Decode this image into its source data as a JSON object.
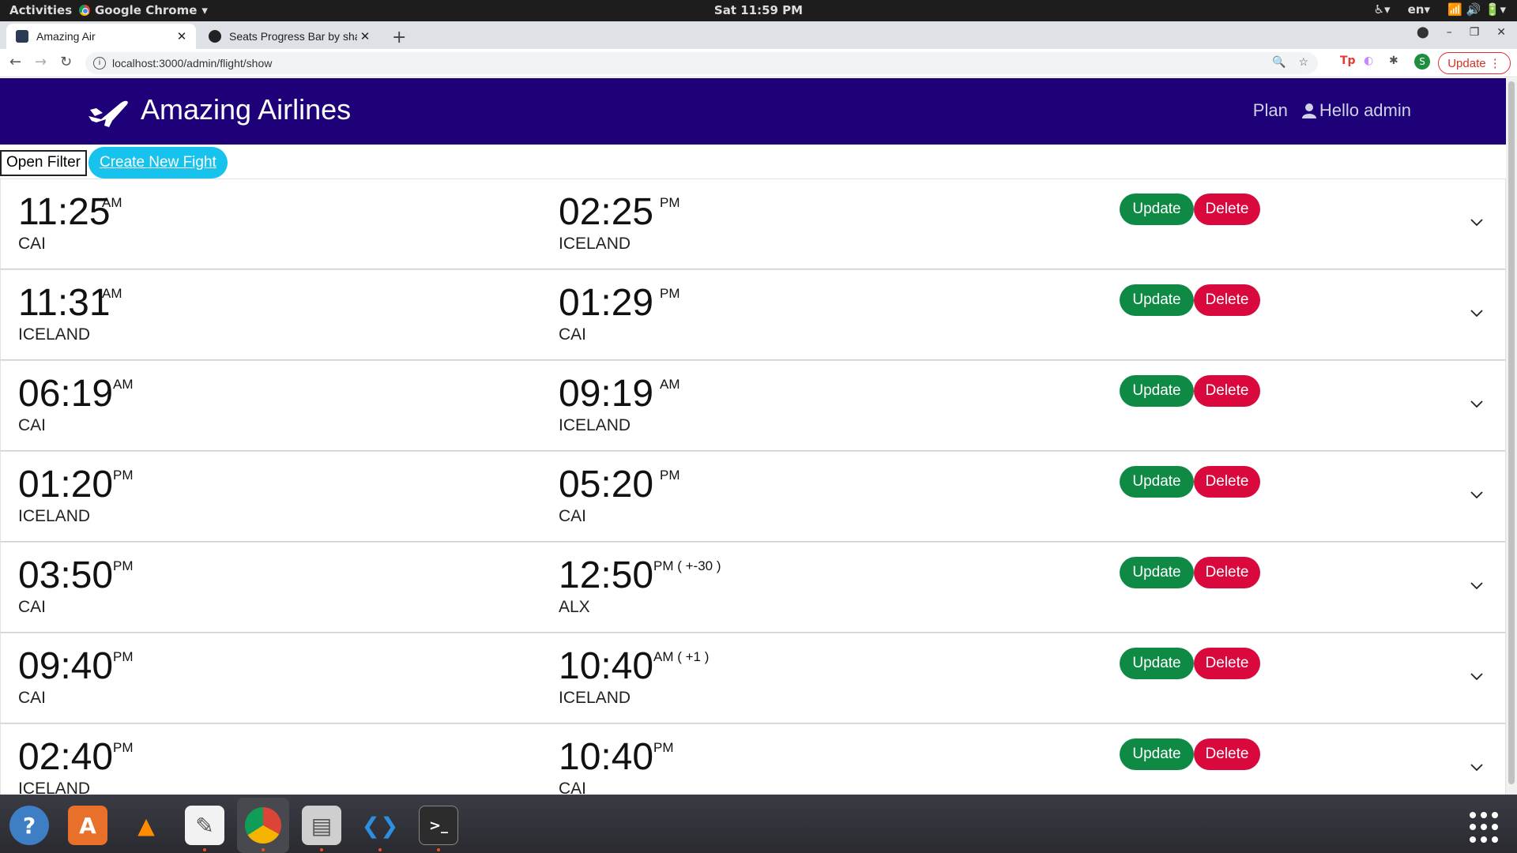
{
  "system": {
    "activities": "Activities",
    "app_menu": "Google Chrome",
    "clock": "Sat 11:59 PM",
    "language": "en"
  },
  "browser": {
    "tabs": [
      {
        "title": "Amazing Air",
        "active": true
      },
      {
        "title": "Seats Progress Bar by sha",
        "active": false
      }
    ],
    "url": "localhost:3000/admin/flight/show",
    "update_label": "Update",
    "profile_initial": "S"
  },
  "site": {
    "brand": "Amazing Airlines",
    "nav": {
      "plan": "Plan",
      "user": "Hello admin"
    },
    "open_filter": "Open Filter",
    "create_flight": "Create New Fight",
    "update_label": "Update",
    "delete_label": "Delete"
  },
  "flights": [
    {
      "dep_time": "11:25",
      "dep_ampm": "AM",
      "dep_city": "CAI",
      "arr_time": "02:25",
      "arr_ampm": "PM",
      "arr_city": "ICELAND"
    },
    {
      "dep_time": "11:31",
      "dep_ampm": "AM",
      "dep_city": "ICELAND",
      "arr_time": "01:29",
      "arr_ampm": "PM",
      "arr_city": "CAI"
    },
    {
      "dep_time": "06:19",
      "dep_ampm": "AM",
      "dep_city": "CAI",
      "arr_time": "09:19",
      "arr_ampm": "AM",
      "arr_city": "ICELAND"
    },
    {
      "dep_time": "01:20",
      "dep_ampm": "PM",
      "dep_city": "ICELAND",
      "arr_time": "05:20",
      "arr_ampm": "PM",
      "arr_city": "CAI"
    },
    {
      "dep_time": "03:50",
      "dep_ampm": "PM",
      "dep_city": "CAI",
      "arr_time": "12:50",
      "arr_ampm": "PM ( +-30 )",
      "arr_city": "ALX"
    },
    {
      "dep_time": "09:40",
      "dep_ampm": "PM",
      "dep_city": "CAI",
      "arr_time": "10:40",
      "arr_ampm": "AM ( +1 )",
      "arr_city": "ICELAND"
    },
    {
      "dep_time": "02:40",
      "dep_ampm": "PM",
      "dep_city": "ICELAND",
      "arr_time": "10:40",
      "arr_ampm": "PM",
      "arr_city": "CAI"
    }
  ],
  "colors": {
    "navbar": "#1e0078",
    "update": "#0f8a45",
    "delete": "#d9093e",
    "create": "#17c2ec"
  }
}
